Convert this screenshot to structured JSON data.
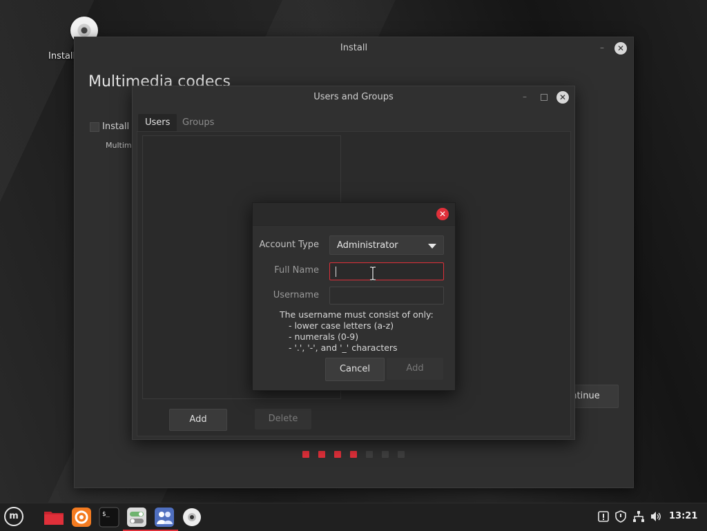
{
  "desktop": {
    "icon_label": "Install"
  },
  "install_window": {
    "title": "Install",
    "heading": "Multimedia codecs",
    "checkbox_label": "Install m",
    "sub_label": "Multime",
    "continue_label": "ntinue",
    "progress": {
      "steps_total": 7,
      "steps_completed": 4,
      "active_color": "#e0303a",
      "inactive_color": "#3f3f3f"
    }
  },
  "users_window": {
    "title": "Users and Groups",
    "tabs": [
      {
        "label": "Users",
        "active": true
      },
      {
        "label": "Groups",
        "active": false
      }
    ],
    "add_label": "Add",
    "delete_label": "Delete"
  },
  "dialog": {
    "account_type_label": "Account Type",
    "account_type_value": "Administrator",
    "full_name_label": "Full Name",
    "full_name_value": "",
    "username_label": "Username",
    "username_value": "",
    "note": [
      "The username must consist of only:",
      "- lower case letters (a-z)",
      "- numerals (0-9)",
      "- '.', '-', and '_' characters"
    ],
    "cancel_label": "Cancel",
    "add_label": "Add"
  },
  "taskbar": {
    "apps": [
      {
        "name": "menu-icon"
      },
      {
        "name": "files-icon",
        "color": "#e0303a"
      },
      {
        "name": "firefox-icon",
        "color": "#f47b20"
      },
      {
        "name": "terminal-icon"
      },
      {
        "name": "settings-toggle-icon"
      },
      {
        "name": "users-groups-icon",
        "color": "#4f6fbf"
      },
      {
        "name": "installer-disc-icon"
      }
    ],
    "tray": [
      "update-icon",
      "shield-icon",
      "network-icon",
      "volume-icon"
    ],
    "clock": "13:21"
  },
  "colors": {
    "accent": "#e0303a"
  }
}
